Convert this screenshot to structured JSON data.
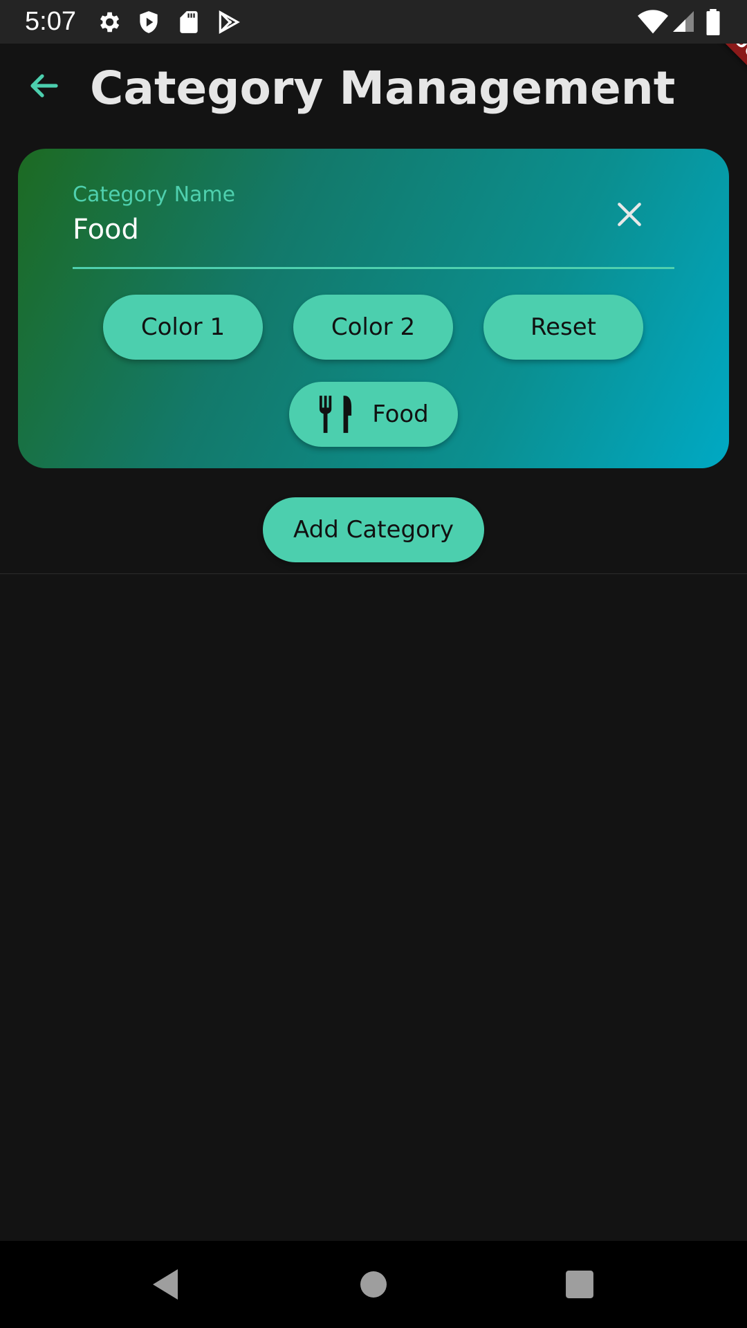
{
  "status_bar": {
    "time": "5:07",
    "icons": [
      "settings-icon",
      "shield-play-icon",
      "sd-card-icon",
      "play-store-icon",
      "wifi-icon",
      "signal-icon",
      "battery-icon"
    ]
  },
  "debug_banner": {
    "text": "DEBUG"
  },
  "app_bar": {
    "title": "Category Management",
    "back_icon": "arrow-left-icon"
  },
  "category_form": {
    "name_label": "Category Name",
    "name_value": "Food",
    "clear_icon": "close-icon",
    "buttons": {
      "color1": "Color 1",
      "color2": "Color 2",
      "reset": "Reset"
    },
    "icon_button": {
      "icon": "utensils-icon",
      "label": "Food"
    }
  },
  "add_button": {
    "label": "Add Category"
  },
  "colors": {
    "background": "#131313",
    "accent": "#4ccfae",
    "gradient_start": "#1d6a22",
    "gradient_end": "#00a9c4"
  },
  "nav_bar": {
    "icons": [
      "back-triangle-icon",
      "home-circle-icon",
      "recents-square-icon"
    ]
  }
}
